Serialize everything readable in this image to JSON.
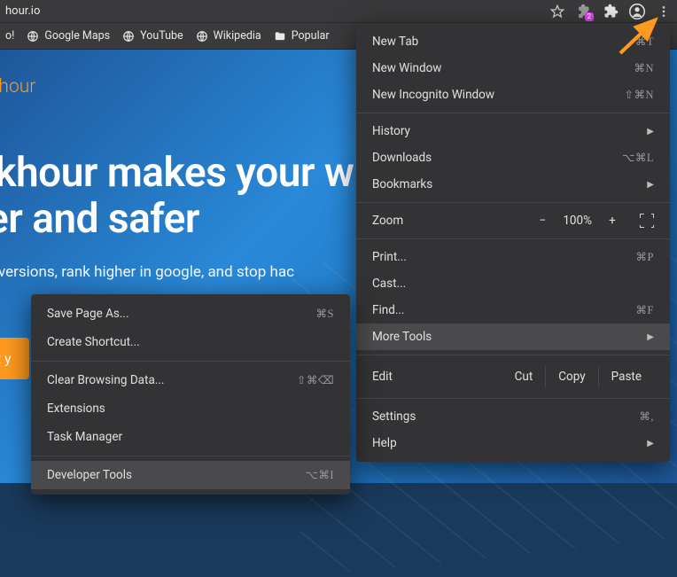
{
  "toolbar": {
    "url_fragment": "hour.io",
    "extension_badge": "2"
  },
  "bookmarks": {
    "items": [
      {
        "label": "o!",
        "icon": "y"
      },
      {
        "label": "Google Maps",
        "icon": "globe"
      },
      {
        "label": "YouTube",
        "icon": "globe"
      },
      {
        "label": "Wikipedia",
        "icon": "globe"
      },
      {
        "label": "Popular",
        "icon": "folder"
      }
    ]
  },
  "page": {
    "logo": "eakhour",
    "hero_title_line1": "akhour makes your w",
    "hero_title_line2": "ter and safer",
    "hero_sub": "conversions, rank higher in google, and stop hac",
    "cta": "rt y"
  },
  "menu": {
    "new_tab": "New Tab",
    "new_tab_sc": "⌘T",
    "new_window": "New Window",
    "new_window_sc": "⌘N",
    "incognito": "New Incognito Window",
    "incognito_sc": "⇧⌘N",
    "history": "History",
    "downloads": "Downloads",
    "downloads_sc": "⌥⌘L",
    "bookmarks": "Bookmarks",
    "zoom_label": "Zoom",
    "zoom_value": "100%",
    "zoom_minus": "−",
    "zoom_plus": "+",
    "print": "Print...",
    "print_sc": "⌘P",
    "cast": "Cast...",
    "find": "Find...",
    "find_sc": "⌘F",
    "more_tools": "More Tools",
    "edit_label": "Edit",
    "edit_cut": "Cut",
    "edit_copy": "Copy",
    "edit_paste": "Paste",
    "settings": "Settings",
    "settings_sc": "⌘,",
    "help": "Help"
  },
  "submenu": {
    "save_page": "Save Page As...",
    "save_page_sc": "⌘S",
    "create_shortcut": "Create Shortcut...",
    "clear_browsing": "Clear Browsing Data...",
    "clear_browsing_sc": "⇧⌘⌫",
    "extensions": "Extensions",
    "task_manager": "Task Manager",
    "developer_tools": "Developer Tools",
    "developer_tools_sc": "⌥⌘I"
  }
}
